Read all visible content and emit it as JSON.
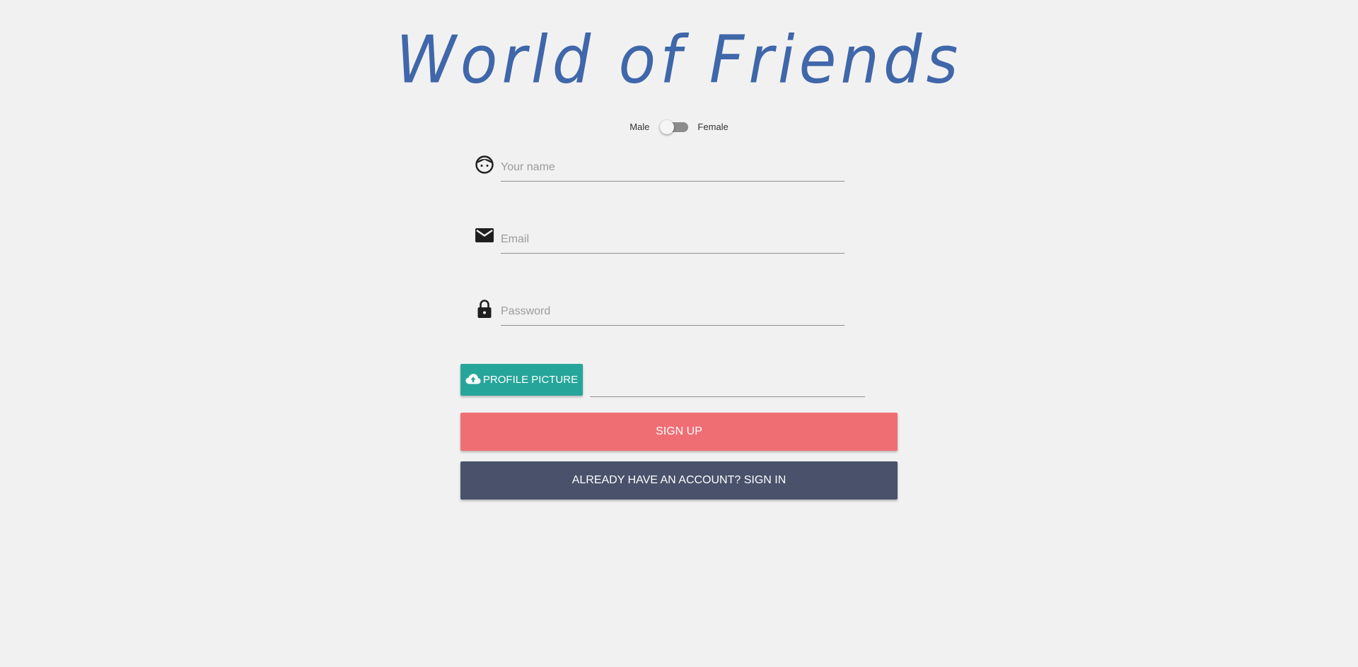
{
  "header": {
    "title": "World of Friends"
  },
  "gender_switch": {
    "left_label": "Male",
    "right_label": "Female",
    "selected": "Male"
  },
  "form": {
    "name": {
      "placeholder": "Your name",
      "value": "",
      "icon": "face-icon"
    },
    "email": {
      "placeholder": "Email",
      "value": "",
      "icon": "mail-icon"
    },
    "password": {
      "placeholder": "Password",
      "value": "",
      "icon": "lock-icon"
    }
  },
  "upload": {
    "label": "PROFILE PICTURE",
    "icon": "cloud-upload-icon",
    "file_path": ""
  },
  "actions": {
    "signup_label": "SIGN UP",
    "signin_label": "ALREADY HAVE AN ACCOUNT? SIGN IN"
  },
  "colors": {
    "background": "#f2f1f2",
    "title": "#3f67aa",
    "upload_button": "#26a69a",
    "signup_button": "#ef6e74",
    "signin_button": "#49526a"
  }
}
